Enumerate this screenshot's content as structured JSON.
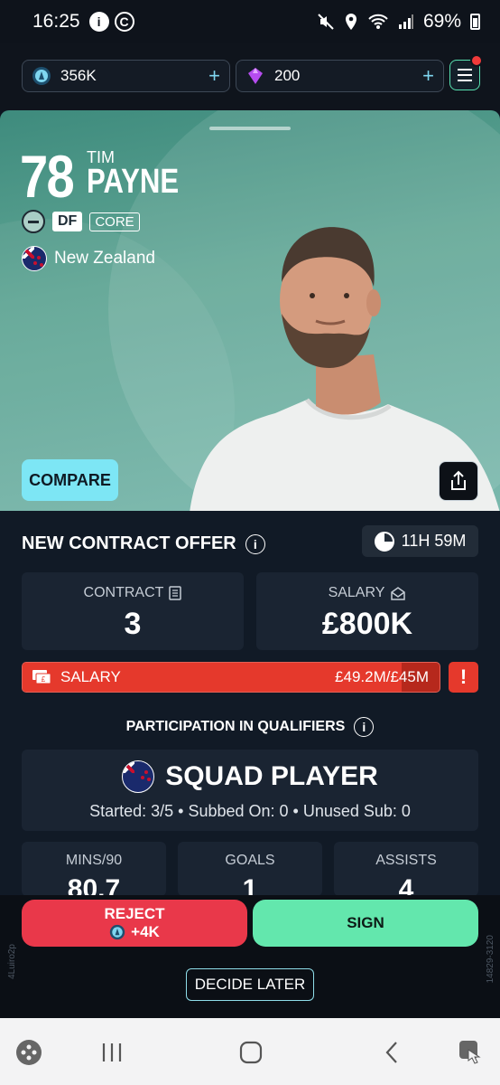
{
  "status_bar": {
    "time": "16:25",
    "battery": "69%"
  },
  "currency": [
    {
      "name": "coins",
      "value": "356K",
      "plus": "+"
    },
    {
      "name": "gems",
      "value": "200",
      "plus": "+"
    }
  ],
  "player": {
    "rating": "78",
    "first_name": "TIM",
    "last_name": "PAYNE",
    "position": "DF",
    "role": "CORE",
    "nation": "New Zealand"
  },
  "hero": {
    "compare_label": "COMPARE"
  },
  "offer": {
    "title": "NEW CONTRACT OFFER",
    "timer": "11H 59M",
    "contract_label": "CONTRACT",
    "contract_value": "3",
    "salary_label": "SALARY",
    "salary_value": "£800K",
    "salary_bar_label": "SALARY",
    "salary_bar_value": "£49.2M/£45M",
    "salary_bar_fill": 0.91,
    "warning": "!"
  },
  "participation": {
    "title": "PARTICIPATION IN QUALIFIERS",
    "status": "SQUAD PLAYER",
    "summary": "Started: 3/5 • Subbed On: 0 • Unused Sub: 0",
    "stats": [
      {
        "label": "MINS/90",
        "value": "80.7"
      },
      {
        "label": "GOALS",
        "value": "1"
      },
      {
        "label": "ASSISTS",
        "value": "4"
      }
    ]
  },
  "actions": {
    "reject_label": "REJECT",
    "reject_bonus": "+4K",
    "sign_label": "SIGN",
    "decide_label": "DECIDE LATER",
    "left_code": "4Luiro2p",
    "right_code": "14829-3120"
  },
  "colors": {
    "accent": "#63e7ad",
    "danger": "#e5392c",
    "compare": "#7de6f5"
  }
}
